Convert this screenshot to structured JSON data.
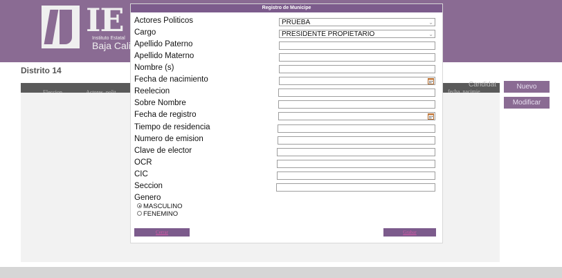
{
  "header": {
    "logo_letters": "IE",
    "logo_subtitle_1": "Instituto Estatal",
    "logo_subtitle_2": "Baja Cali"
  },
  "page": {
    "distrito": "Distrito 14",
    "columns": [
      "Eleccion",
      "Actores_polit"
    ],
    "right_columns": [
      "Candidat",
      "fecha_nacimie"
    ],
    "nuevo_label": "Nuevo",
    "modificar_label": "Modificar"
  },
  "modal": {
    "title": "Registro de Municipe",
    "fields": {
      "actores_politicos": {
        "label": "Actores Politicos",
        "value": "PRUEBA"
      },
      "cargo": {
        "label": "Cargo",
        "value": "PRESIDENTE PROPIETARIO"
      },
      "apellido_paterno": {
        "label": "Apellido Paterno",
        "value": ""
      },
      "apellido_materno": {
        "label": "Apellido Materno",
        "value": ""
      },
      "nombre": {
        "label": "Nombre (s)",
        "value": ""
      },
      "fecha_nacimiento": {
        "label": "Fecha de nacimiento",
        "value": ""
      },
      "reelecion": {
        "label": "Reelecion",
        "value": ""
      },
      "sobre_nombre": {
        "label": "Sobre Nombre",
        "value": ""
      },
      "fecha_registro": {
        "label": "Fecha de registro",
        "value": ""
      },
      "tiempo_residencia": {
        "label": "Tiempo de residencia",
        "value": ""
      },
      "numero_emision": {
        "label": "Numero de emision",
        "value": ""
      },
      "clave_elector": {
        "label": "Clave de elector",
        "value": ""
      },
      "ocr": {
        "label": "OCR",
        "value": ""
      },
      "cic": {
        "label": "CIC",
        "value": ""
      },
      "seccion": {
        "label": "Seccion",
        "value": ""
      }
    },
    "genero": {
      "label": "Genero",
      "options": [
        "MASCULINO",
        "FENEMINO"
      ],
      "selected": "MASCULINO"
    },
    "cerrar_label": "Cerrar",
    "guardar_label": "Grabar"
  },
  "colors": {
    "brand_purple": "#8a6b93",
    "modal_title_bg": "#7c5b8c"
  }
}
